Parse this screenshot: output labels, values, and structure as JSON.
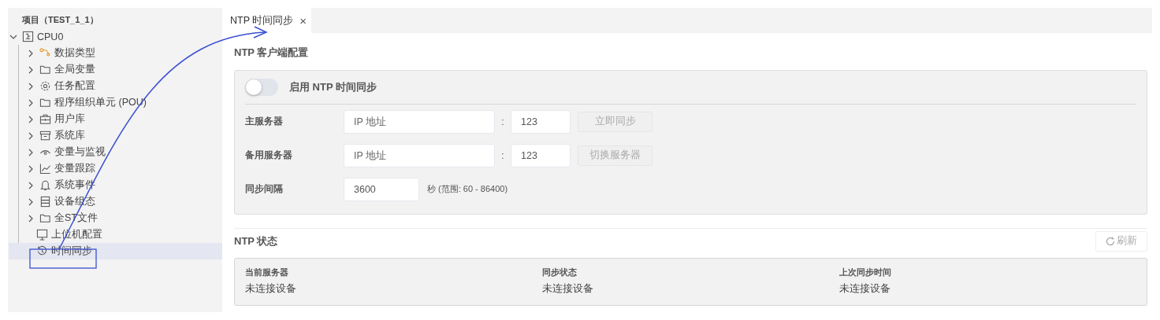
{
  "sidebar": {
    "title": "项目（TEST_1_1）",
    "tree": [
      {
        "label": "CPU0",
        "expanded": true,
        "selected": false,
        "children": [
          {
            "label": "数据类型",
            "expanded": false,
            "selected": false
          },
          {
            "label": "全局变量",
            "expanded": false,
            "selected": false
          },
          {
            "label": "任务配置",
            "expanded": false,
            "selected": false
          },
          {
            "label": "程序组织单元 (POU)",
            "expanded": false,
            "selected": false
          },
          {
            "label": "用户库",
            "expanded": false,
            "selected": false
          },
          {
            "label": "系统库",
            "expanded": false,
            "selected": false
          },
          {
            "label": "变量与监视",
            "expanded": false,
            "selected": false
          },
          {
            "label": "变量跟踪",
            "expanded": false,
            "selected": false
          },
          {
            "label": "系统事件",
            "expanded": false,
            "selected": false
          },
          {
            "label": "设备组态",
            "expanded": false,
            "selected": false
          },
          {
            "label": "全ST文件",
            "expanded": false,
            "selected": false
          },
          {
            "label": "上位机配置",
            "selected": false
          },
          {
            "label": "时间同步",
            "selected": true
          }
        ]
      }
    ]
  },
  "tabs": [
    {
      "label": "NTP 时间同步",
      "selected": true,
      "close": "×"
    }
  ],
  "client_config": {
    "title": "NTP 客户端配置",
    "enable": {
      "label": "启用 NTP 时间同步",
      "on": false
    },
    "rows": [
      {
        "kind": "server",
        "label": "主服务器",
        "placeholder": "IP 地址",
        "separator": ":",
        "port": "123",
        "button": {
          "label": "立即同步",
          "disabled": true
        }
      },
      {
        "kind": "server",
        "label": "备用服务器",
        "placeholder": "IP 地址",
        "separator": ":",
        "port": "123",
        "button": {
          "label": "切换服务器",
          "disabled": true
        }
      },
      {
        "kind": "interval",
        "label": "同步间隔",
        "value": "3600",
        "hint": "秒 (范围: 60 - 86400)"
      }
    ]
  },
  "status": {
    "title": "NTP 状态",
    "refresh": {
      "label": "刷新",
      "disabled": true
    },
    "fields": [
      {
        "label": "当前服务器",
        "value": "未连接设备"
      },
      {
        "label": "同步状态",
        "value": "未连接设备"
      },
      {
        "label": "上次同步时间",
        "value": "未连接设备"
      }
    ]
  }
}
